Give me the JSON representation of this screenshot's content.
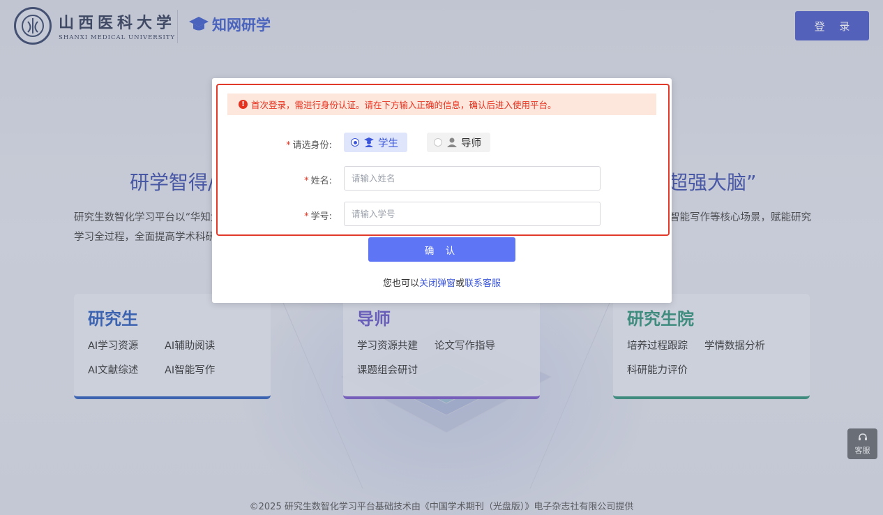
{
  "header": {
    "university_cn": "山西医科大学",
    "university_en": "SHANXI MEDICAL UNIVERSITY",
    "brand": "知网研学",
    "login_label": "登 录"
  },
  "hero": {
    "title_left": "研学智得/",
    "title_right": "超强大脑”",
    "desc_line1": "研究生数智化学习平台以“华知大",
    "desc_line2": "学习全过程，全面提高学术科研",
    "desc_right": "智能写作等核心场景，赋能研究"
  },
  "cards": [
    {
      "title": "研究生",
      "items": [
        "AI学习资源",
        "AI辅助阅读",
        "AI文献综述",
        "AI智能写作"
      ]
    },
    {
      "title": "导师",
      "items": [
        "学习资源共建",
        "论文写作指导",
        "课题组会研讨"
      ]
    },
    {
      "title": "研究生院",
      "items": [
        "培养过程跟踪",
        "学情数据分析",
        "科研能力评价"
      ]
    }
  ],
  "footer": "©2025 研究生数智化学习平台基础技术由《中国学术期刊（光盘版）》电子杂志社有限公司提供",
  "service_label": "客服",
  "modal": {
    "alert": "首次登录，需进行身份认证。请在下方输入正确的信息，确认后进入使用平台。",
    "role_label": "请选身份:",
    "role_student": "学生",
    "role_mentor": "导师",
    "name_label": "姓名:",
    "name_placeholder": "请输入姓名",
    "id_label": "学号:",
    "id_placeholder": "请输入学号",
    "confirm_label": "确 认",
    "foot_prefix": "您也可以",
    "foot_close": "关闭弹窗",
    "foot_or": "或",
    "foot_contact": "联系客服"
  },
  "colors": {
    "primary": "#3b4dc8",
    "confirm": "#5e76f5",
    "alert_text": "#e5321f",
    "alert_bg": "#fde6dc",
    "highlight": "#e23a2a"
  }
}
